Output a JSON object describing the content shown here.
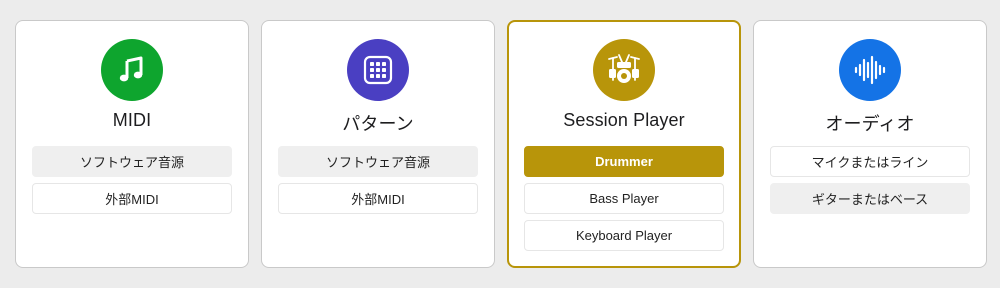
{
  "cards": [
    {
      "title": "MIDI",
      "icon": "music-note-icon",
      "color": "#0ea52e",
      "options": [
        "ソフトウェア音源",
        "外部MIDI"
      ]
    },
    {
      "title": "パターン",
      "icon": "grid-icon",
      "color": "#4a3fc2",
      "options": [
        "ソフトウェア音源",
        "外部MIDI"
      ]
    },
    {
      "title": "Session Player",
      "icon": "drum-kit-icon",
      "color": "#b8950a",
      "selected": true,
      "options": [
        "Drummer",
        "Bass Player",
        "Keyboard Player"
      ],
      "active_option": "Drummer"
    },
    {
      "title": "オーディオ",
      "icon": "waveform-icon",
      "color": "#1473e6",
      "options": [
        "マイクまたはライン",
        "ギターまたはベース"
      ]
    }
  ]
}
